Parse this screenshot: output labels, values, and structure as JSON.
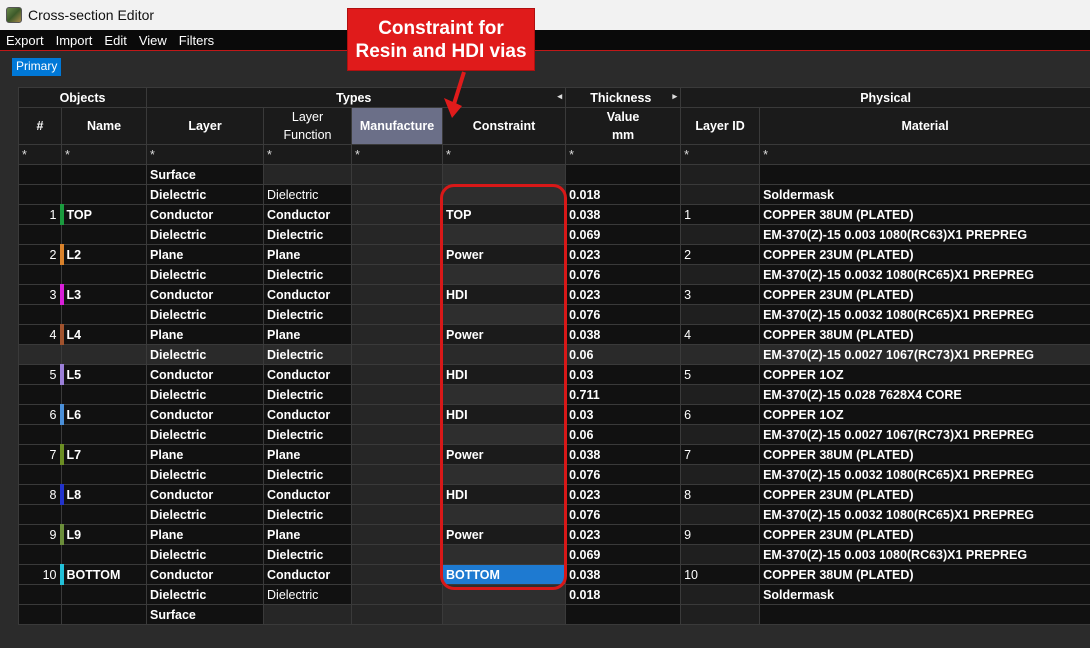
{
  "window": {
    "title": "Cross-section Editor"
  },
  "menu": [
    "Export",
    "Import",
    "Edit",
    "View",
    "Filters"
  ],
  "tabs": [
    {
      "label": "Primary"
    }
  ],
  "callout": {
    "line1": "Constraint for",
    "line2": "Resin and HDI vias"
  },
  "groups": {
    "objects": "Objects",
    "types": "Types",
    "thickness": "Thickness",
    "physical": "Physical"
  },
  "headers": {
    "num": "#",
    "name": "Name",
    "layer": "Layer",
    "layer_function": "Layer Function",
    "manufacture": "Manufacture",
    "constraint": "Constraint",
    "value": "Value",
    "unit": "mm",
    "layer_id": "Layer ID",
    "material": "Material"
  },
  "filter_symbol": "*",
  "rows": [
    {
      "num": "",
      "name": "",
      "layer": "Surface",
      "lf": "",
      "constraint": "",
      "value": "",
      "layer_id": "",
      "material": "",
      "kind": "surface"
    },
    {
      "num": "",
      "name": "",
      "layer": "Dielectric",
      "lf": "Dielectric",
      "constraint": "",
      "value": "0.018",
      "layer_id": "",
      "material": "Soldermask",
      "kind": "diel-white"
    },
    {
      "num": "1",
      "name": "TOP",
      "layer": "Conductor",
      "lf": "Conductor",
      "constraint": "TOP",
      "value": "0.038",
      "layer_id": "1",
      "material": "COPPER 38UM (PLATED)",
      "kind": "cond",
      "swatch": "#1a9b3e"
    },
    {
      "num": "",
      "name": "",
      "layer": "Dielectric",
      "lf": "Dielectric",
      "constraint": "",
      "value": "0.069",
      "layer_id": "",
      "material": "EM-370(Z)-15 0.003 1080(RC63)X1 PREPREG",
      "kind": "diel"
    },
    {
      "num": "2",
      "name": "L2",
      "layer": "Plane",
      "lf": "Plane",
      "constraint": "Power",
      "value": "0.023",
      "layer_id": "2",
      "material": "COPPER 23UM (PLATED)",
      "kind": "plane",
      "swatch": "#d9822b"
    },
    {
      "num": "",
      "name": "",
      "layer": "Dielectric",
      "lf": "Dielectric",
      "constraint": "",
      "value": "0.076",
      "layer_id": "",
      "material": "EM-370(Z)-15 0.0032 1080(RC65)X1 PREPREG",
      "kind": "diel"
    },
    {
      "num": "3",
      "name": "L3",
      "layer": "Conductor",
      "lf": "Conductor",
      "constraint": "HDI",
      "value": "0.023",
      "layer_id": "3",
      "material": "COPPER 23UM (PLATED)",
      "kind": "cond",
      "swatch": "#d81fd8"
    },
    {
      "num": "",
      "name": "",
      "layer": "Dielectric",
      "lf": "Dielectric",
      "constraint": "",
      "value": "0.076",
      "layer_id": "",
      "material": "EM-370(Z)-15 0.0032 1080(RC65)X1 PREPREG",
      "kind": "diel"
    },
    {
      "num": "4",
      "name": "L4",
      "layer": "Plane",
      "lf": "Plane",
      "constraint": "Power",
      "value": "0.038",
      "layer_id": "4",
      "material": "COPPER 38UM (PLATED)",
      "kind": "plane",
      "swatch": "#a0522d"
    },
    {
      "num": "",
      "name": "",
      "layer": "Dielectric",
      "lf": "Dielectric",
      "constraint": "",
      "value": "0.06",
      "layer_id": "",
      "material": "EM-370(Z)-15 0.0027 1067(RC73)X1 PREPREG",
      "kind": "diel",
      "highlight": true
    },
    {
      "num": "5",
      "name": "L5",
      "layer": "Conductor",
      "lf": "Conductor",
      "constraint": "HDI",
      "value": "0.03",
      "layer_id": "5",
      "material": "COPPER 1OZ",
      "kind": "cond",
      "swatch": "#9b7fd8"
    },
    {
      "num": "",
      "name": "",
      "layer": "Dielectric",
      "lf": "Dielectric",
      "constraint": "",
      "value": "0.711",
      "layer_id": "",
      "material": "EM-370(Z)-15 0.028 7628X4 CORE",
      "kind": "diel"
    },
    {
      "num": "6",
      "name": "L6",
      "layer": "Conductor",
      "lf": "Conductor",
      "constraint": "HDI",
      "value": "0.03",
      "layer_id": "6",
      "material": "COPPER 1OZ",
      "kind": "cond",
      "swatch": "#4a8fd8"
    },
    {
      "num": "",
      "name": "",
      "layer": "Dielectric",
      "lf": "Dielectric",
      "constraint": "",
      "value": "0.06",
      "layer_id": "",
      "material": "EM-370(Z)-15 0.0027 1067(RC73)X1 PREPREG",
      "kind": "diel"
    },
    {
      "num": "7",
      "name": "L7",
      "layer": "Plane",
      "lf": "Plane",
      "constraint": "Power",
      "value": "0.038",
      "layer_id": "7",
      "material": "COPPER 38UM (PLATED)",
      "kind": "plane",
      "swatch": "#6b8e23"
    },
    {
      "num": "",
      "name": "",
      "layer": "Dielectric",
      "lf": "Dielectric",
      "constraint": "",
      "value": "0.076",
      "layer_id": "",
      "material": "EM-370(Z)-15 0.0032 1080(RC65)X1 PREPREG",
      "kind": "diel"
    },
    {
      "num": "8",
      "name": "L8",
      "layer": "Conductor",
      "lf": "Conductor",
      "constraint": "HDI",
      "value": "0.023",
      "layer_id": "8",
      "material": "COPPER 23UM (PLATED)",
      "kind": "cond",
      "swatch": "#2233cc"
    },
    {
      "num": "",
      "name": "",
      "layer": "Dielectric",
      "lf": "Dielectric",
      "constraint": "",
      "value": "0.076",
      "layer_id": "",
      "material": "EM-370(Z)-15 0.0032 1080(RC65)X1 PREPREG",
      "kind": "diel"
    },
    {
      "num": "9",
      "name": "L9",
      "layer": "Plane",
      "lf": "Plane",
      "constraint": "Power",
      "value": "0.023",
      "layer_id": "9",
      "material": "COPPER 23UM (PLATED)",
      "kind": "plane",
      "swatch": "#6b8e3a"
    },
    {
      "num": "",
      "name": "",
      "layer": "Dielectric",
      "lf": "Dielectric",
      "constraint": "",
      "value": "0.069",
      "layer_id": "",
      "material": "EM-370(Z)-15 0.003 1080(RC63)X1 PREPREG",
      "kind": "diel"
    },
    {
      "num": "10",
      "name": "BOTTOM",
      "layer": "Conductor",
      "lf": "Conductor",
      "constraint": "BOTTOM",
      "value": "0.038",
      "layer_id": "10",
      "material": "COPPER 38UM (PLATED)",
      "kind": "cond",
      "swatch": "#22c0d8",
      "selected": true
    },
    {
      "num": "",
      "name": "",
      "layer": "Dielectric",
      "lf": "Dielectric",
      "constraint": "",
      "value": "0.018",
      "layer_id": "",
      "material": "Soldermask",
      "kind": "diel-white"
    },
    {
      "num": "",
      "name": "",
      "layer": "Surface",
      "lf": "",
      "constraint": "",
      "value": "",
      "layer_id": "",
      "material": "",
      "kind": "surface"
    }
  ]
}
